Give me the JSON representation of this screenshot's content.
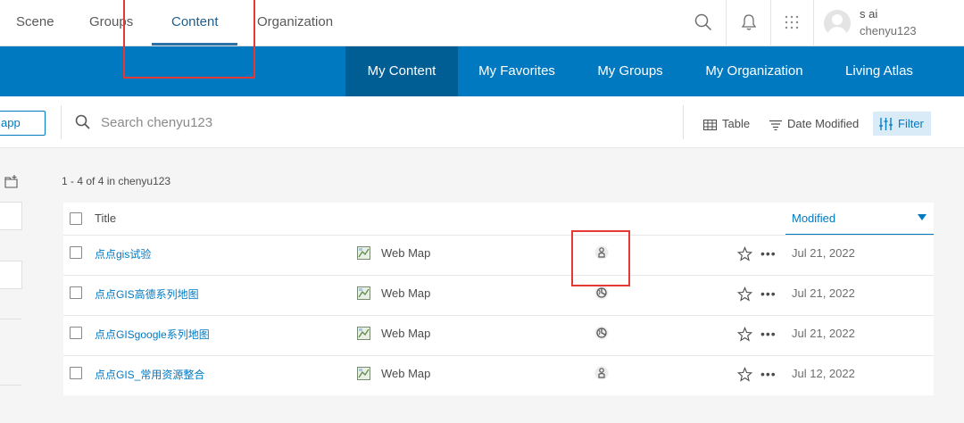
{
  "topnav": {
    "items": [
      {
        "label": "Scene"
      },
      {
        "label": "Groups"
      },
      {
        "label": "Content"
      },
      {
        "label": "Organization"
      }
    ],
    "active": "Content"
  },
  "user": {
    "name": "s ai",
    "username": "chenyu123"
  },
  "icons": {
    "search": "search-icon",
    "notifications": "bell-icon",
    "apps": "app-launcher-icon",
    "avatar": "user-avatar"
  },
  "subnav": {
    "items": [
      {
        "label": "My Content"
      },
      {
        "label": "My Favorites"
      },
      {
        "label": "My Groups"
      },
      {
        "label": "My Organization"
      },
      {
        "label": "Living Atlas"
      }
    ],
    "active": "My Content"
  },
  "toolbar": {
    "app_button_label": "app",
    "search_placeholder": "Search chenyu123",
    "view_label": "Table",
    "sort_label": "Date Modified",
    "filter_label": "Filter"
  },
  "content": {
    "count_text": "1 - 4 of 4 in chenyu123",
    "columns": {
      "title": "Title",
      "modified": "Modified"
    },
    "rows": [
      {
        "title": "点点gis试验",
        "type": "Web Map",
        "sharing": "private",
        "modified": "Jul 21, 2022"
      },
      {
        "title": "点点GIS高德系列地图",
        "type": "Web Map",
        "sharing": "public",
        "modified": "Jul 21, 2022"
      },
      {
        "title": "点点GISgoogle系列地图",
        "type": "Web Map",
        "sharing": "public",
        "modified": "Jul 21, 2022"
      },
      {
        "title": "点点GIS_常用资源整合",
        "type": "Web Map",
        "sharing": "private",
        "modified": "Jul 12, 2022"
      }
    ]
  },
  "colors": {
    "brand_blue": "#0079c1",
    "active_tab_dark": "#005e95",
    "annotation_red": "#e53935"
  }
}
